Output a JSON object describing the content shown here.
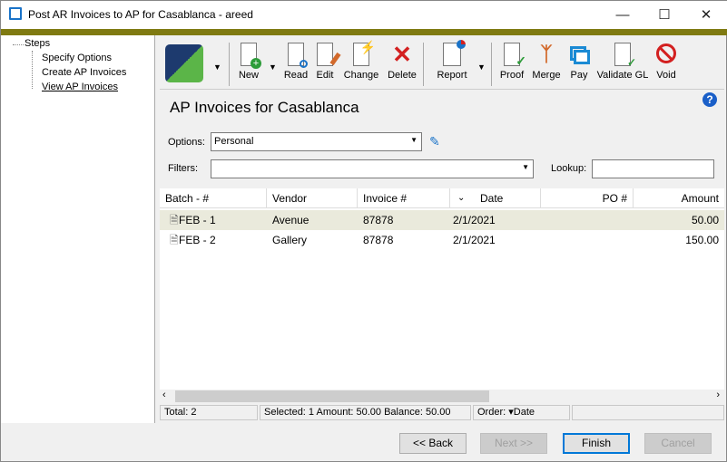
{
  "window": {
    "title": "Post AR Invoices to AP for Casablanca - areed"
  },
  "steps": {
    "root": "Steps",
    "items": [
      "Specify Options",
      "Create AP Invoices",
      "View AP Invoices"
    ]
  },
  "toolbar": {
    "new": "New",
    "read": "Read",
    "edit": "Edit",
    "change": "Change",
    "delete": "Delete",
    "report": "Report",
    "proof": "Proof",
    "merge": "Merge",
    "pay": "Pay",
    "validate_gl": "Validate GL",
    "void": "Void"
  },
  "main": {
    "title": "AP Invoices for Casablanca",
    "options_label": "Options:",
    "options_value": "Personal",
    "filters_label": "Filters:",
    "filters_value": "",
    "lookup_label": "Lookup:",
    "lookup_value": ""
  },
  "table": {
    "headers": [
      "Batch - #",
      "Vendor",
      "Invoice #",
      "Date",
      "PO #",
      "Amount"
    ],
    "rows": [
      [
        "FEB - 1",
        "Avenue",
        "87878",
        "2/1/2021",
        "",
        "50.00"
      ],
      [
        "FEB - 2",
        "Gallery",
        "87878",
        "2/1/2021",
        "",
        "150.00"
      ]
    ]
  },
  "status": {
    "total": "Total: 2",
    "selection": "Selected: 1  Amount: 50.00  Balance: 50.00",
    "order": "Order: ▾Date"
  },
  "buttons": {
    "back": "<< Back",
    "next": "Next >>",
    "finish": "Finish",
    "cancel": "Cancel"
  }
}
